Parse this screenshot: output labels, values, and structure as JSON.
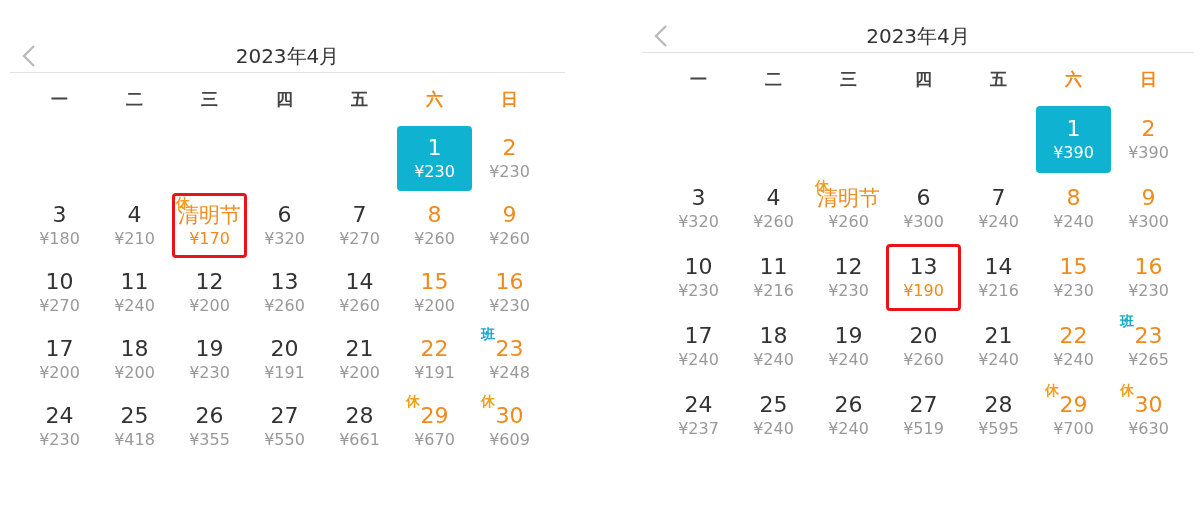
{
  "calendars": [
    {
      "title": "2023年4月",
      "weekdays": [
        {
          "label": "一",
          "weekend": false
        },
        {
          "label": "二",
          "weekend": false
        },
        {
          "label": "三",
          "weekend": false
        },
        {
          "label": "四",
          "weekend": false
        },
        {
          "label": "五",
          "weekend": false
        },
        {
          "label": "六",
          "weekend": true
        },
        {
          "label": "日",
          "weekend": true
        }
      ],
      "weeks": [
        [
          {
            "label": "1",
            "price": "¥230",
            "kind": "weekend",
            "selected": true,
            "boxed": false
          },
          {
            "label": "2",
            "price": "¥230",
            "kind": "weekend",
            "selected": false,
            "boxed": false
          }
        ],
        [
          {
            "label": "3",
            "price": "¥180",
            "kind": "weekday",
            "selected": false,
            "boxed": false
          },
          {
            "label": "4",
            "price": "¥210",
            "kind": "weekday",
            "selected": false,
            "boxed": false
          },
          {
            "label": "清明节",
            "price": "¥170",
            "kind": "holiday",
            "selected": false,
            "boxed": true,
            "tag": {
              "label": "休",
              "color": "#f0a020"
            }
          },
          {
            "label": "6",
            "price": "¥320",
            "kind": "weekday",
            "selected": false,
            "boxed": false
          },
          {
            "label": "7",
            "price": "¥270",
            "kind": "weekday",
            "selected": false,
            "boxed": false
          },
          {
            "label": "8",
            "price": "¥260",
            "kind": "weekend",
            "selected": false,
            "boxed": false
          },
          {
            "label": "9",
            "price": "¥260",
            "kind": "weekend",
            "selected": false,
            "boxed": false
          }
        ],
        [
          {
            "label": "10",
            "price": "¥270",
            "kind": "weekday",
            "selected": false,
            "boxed": false
          },
          {
            "label": "11",
            "price": "¥240",
            "kind": "weekday",
            "selected": false,
            "boxed": false
          },
          {
            "label": "12",
            "price": "¥200",
            "kind": "weekday",
            "selected": false,
            "boxed": false
          },
          {
            "label": "13",
            "price": "¥260",
            "kind": "weekday",
            "selected": false,
            "boxed": false
          },
          {
            "label": "14",
            "price": "¥260",
            "kind": "weekday",
            "selected": false,
            "boxed": false
          },
          {
            "label": "15",
            "price": "¥200",
            "kind": "weekend",
            "selected": false,
            "boxed": false
          },
          {
            "label": "16",
            "price": "¥230",
            "kind": "weekend",
            "selected": false,
            "boxed": false
          }
        ],
        [
          {
            "label": "17",
            "price": "¥200",
            "kind": "weekday",
            "selected": false,
            "boxed": false
          },
          {
            "label": "18",
            "price": "¥200",
            "kind": "weekday",
            "selected": false,
            "boxed": false
          },
          {
            "label": "19",
            "price": "¥230",
            "kind": "weekday",
            "selected": false,
            "boxed": false
          },
          {
            "label": "20",
            "price": "¥191",
            "kind": "weekday",
            "selected": false,
            "boxed": false
          },
          {
            "label": "21",
            "price": "¥200",
            "kind": "weekday",
            "selected": false,
            "boxed": false
          },
          {
            "label": "22",
            "price": "¥191",
            "kind": "weekend",
            "selected": false,
            "boxed": false
          },
          {
            "label": "23",
            "price": "¥248",
            "kind": "weekend",
            "selected": false,
            "boxed": false,
            "tag": {
              "label": "班",
              "color": "#18a8cc"
            }
          }
        ],
        [
          {
            "label": "24",
            "price": "¥230",
            "kind": "weekday",
            "selected": false,
            "boxed": false
          },
          {
            "label": "25",
            "price": "¥418",
            "kind": "weekday",
            "selected": false,
            "boxed": false
          },
          {
            "label": "26",
            "price": "¥355",
            "kind": "weekday",
            "selected": false,
            "boxed": false
          },
          {
            "label": "27",
            "price": "¥550",
            "kind": "weekday",
            "selected": false,
            "boxed": false
          },
          {
            "label": "28",
            "price": "¥661",
            "kind": "weekday",
            "selected": false,
            "boxed": false
          },
          {
            "label": "29",
            "price": "¥670",
            "kind": "weekend",
            "selected": false,
            "boxed": false,
            "tag": {
              "label": "休",
              "color": "#f0a020"
            }
          },
          {
            "label": "30",
            "price": "¥609",
            "kind": "weekend",
            "selected": false,
            "boxed": false,
            "tag": {
              "label": "休",
              "color": "#f0a020"
            }
          }
        ]
      ]
    },
    {
      "title": "2023年4月",
      "weekdays": [
        {
          "label": "一",
          "weekend": false
        },
        {
          "label": "二",
          "weekend": false
        },
        {
          "label": "三",
          "weekend": false
        },
        {
          "label": "四",
          "weekend": false
        },
        {
          "label": "五",
          "weekend": false
        },
        {
          "label": "六",
          "weekend": true
        },
        {
          "label": "日",
          "weekend": true
        }
      ],
      "weeks": [
        [
          {
            "label": "1",
            "price": "¥390",
            "kind": "weekend",
            "selected": true,
            "boxed": false
          },
          {
            "label": "2",
            "price": "¥390",
            "kind": "weekend",
            "selected": false,
            "boxed": false
          }
        ],
        [
          {
            "label": "3",
            "price": "¥320",
            "kind": "weekday",
            "selected": false,
            "boxed": false
          },
          {
            "label": "4",
            "price": "¥260",
            "kind": "weekday",
            "selected": false,
            "boxed": false
          },
          {
            "label": "清明节",
            "price": "¥260",
            "kind": "holiday",
            "selected": false,
            "boxed": false,
            "tag": {
              "label": "休",
              "color": "#f0a020"
            }
          },
          {
            "label": "6",
            "price": "¥300",
            "kind": "weekday",
            "selected": false,
            "boxed": false
          },
          {
            "label": "7",
            "price": "¥240",
            "kind": "weekday",
            "selected": false,
            "boxed": false
          },
          {
            "label": "8",
            "price": "¥240",
            "kind": "weekend",
            "selected": false,
            "boxed": false
          },
          {
            "label": "9",
            "price": "¥300",
            "kind": "weekend",
            "selected": false,
            "boxed": false
          }
        ],
        [
          {
            "label": "10",
            "price": "¥230",
            "kind": "weekday",
            "selected": false,
            "boxed": false
          },
          {
            "label": "11",
            "price": "¥216",
            "kind": "weekday",
            "selected": false,
            "boxed": false
          },
          {
            "label": "12",
            "price": "¥230",
            "kind": "weekday",
            "selected": false,
            "boxed": false
          },
          {
            "label": "13",
            "price": "¥190",
            "kind": "weekday",
            "selected": false,
            "boxed": true
          },
          {
            "label": "14",
            "price": "¥216",
            "kind": "weekday",
            "selected": false,
            "boxed": false
          },
          {
            "label": "15",
            "price": "¥230",
            "kind": "weekend",
            "selected": false,
            "boxed": false
          },
          {
            "label": "16",
            "price": "¥230",
            "kind": "weekend",
            "selected": false,
            "boxed": false
          }
        ],
        [
          {
            "label": "17",
            "price": "¥240",
            "kind": "weekday",
            "selected": false,
            "boxed": false
          },
          {
            "label": "18",
            "price": "¥240",
            "kind": "weekday",
            "selected": false,
            "boxed": false
          },
          {
            "label": "19",
            "price": "¥240",
            "kind": "weekday",
            "selected": false,
            "boxed": false
          },
          {
            "label": "20",
            "price": "¥260",
            "kind": "weekday",
            "selected": false,
            "boxed": false
          },
          {
            "label": "21",
            "price": "¥240",
            "kind": "weekday",
            "selected": false,
            "boxed": false
          },
          {
            "label": "22",
            "price": "¥240",
            "kind": "weekend",
            "selected": false,
            "boxed": false
          },
          {
            "label": "23",
            "price": "¥265",
            "kind": "weekend",
            "selected": false,
            "boxed": false,
            "tag": {
              "label": "班",
              "color": "#18a8cc"
            }
          }
        ],
        [
          {
            "label": "24",
            "price": "¥237",
            "kind": "weekday",
            "selected": false,
            "boxed": false
          },
          {
            "label": "25",
            "price": "¥240",
            "kind": "weekday",
            "selected": false,
            "boxed": false
          },
          {
            "label": "26",
            "price": "¥240",
            "kind": "weekday",
            "selected": false,
            "boxed": false
          },
          {
            "label": "27",
            "price": "¥519",
            "kind": "weekday",
            "selected": false,
            "boxed": false
          },
          {
            "label": "28",
            "price": "¥595",
            "kind": "weekday",
            "selected": false,
            "boxed": false
          },
          {
            "label": "29",
            "price": "¥700",
            "kind": "weekend",
            "selected": false,
            "boxed": false,
            "tag": {
              "label": "休",
              "color": "#f0a020"
            }
          },
          {
            "label": "30",
            "price": "¥630",
            "kind": "weekend",
            "selected": false,
            "boxed": false,
            "tag": {
              "label": "休",
              "color": "#f0a020"
            }
          }
        ]
      ]
    }
  ]
}
